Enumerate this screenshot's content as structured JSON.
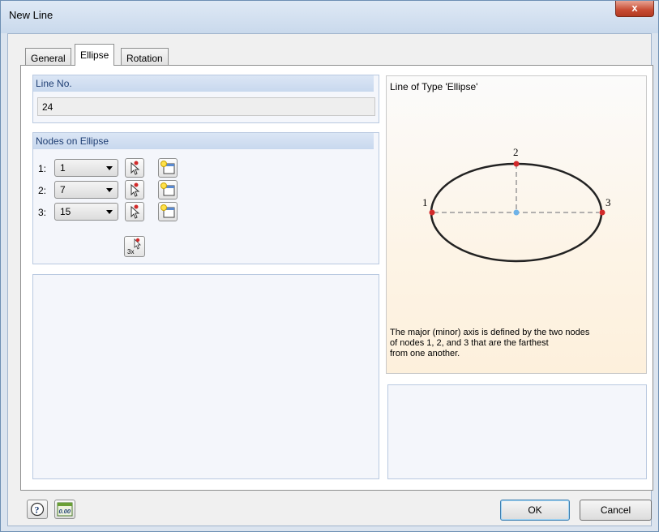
{
  "window": {
    "title": "New Line",
    "close_glyph": "x"
  },
  "tabs": [
    {
      "label": "General",
      "active": false
    },
    {
      "label": "Ellipse",
      "active": true
    },
    {
      "label": "Rotation",
      "active": false
    }
  ],
  "line_no": {
    "header": "Line No.",
    "value": "24"
  },
  "nodes": {
    "header": "Nodes on Ellipse",
    "rows": [
      {
        "label": "1:",
        "value": "1"
      },
      {
        "label": "2:",
        "value": "7"
      },
      {
        "label": "3:",
        "value": "15"
      }
    ],
    "multi_pick_label": "3x"
  },
  "preview": {
    "title": "Line of Type 'Ellipse'",
    "node_labels": [
      "1",
      "2",
      "3"
    ],
    "description_lines": [
      "The major (minor) axis is defined by the two nodes",
      "of nodes 1, 2, and 3 that are the farthest",
      "from one another."
    ]
  },
  "footer": {
    "help_icon": "help-icon",
    "units_icon_text": "0.00",
    "ok_label": "OK",
    "cancel_label": "Cancel"
  },
  "colors": {
    "accent_header": "#1f3f74",
    "node_red": "#d22a2a",
    "center_blue": "#6fb3e8",
    "close_red": "#c74b32"
  }
}
